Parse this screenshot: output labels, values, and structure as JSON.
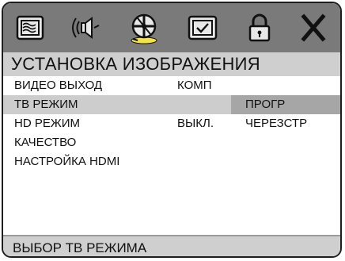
{
  "toolbar": {
    "tabs": [
      {
        "icon": "display-settings-icon"
      },
      {
        "icon": "audio-speaker-icon"
      },
      {
        "icon": "video-disc-icon",
        "active": true
      },
      {
        "icon": "preferences-check-icon"
      },
      {
        "icon": "lock-icon"
      },
      {
        "icon": "close-icon"
      }
    ]
  },
  "header": {
    "title": "УСТАНОВКА ИЗОБРАЖЕНИЯ"
  },
  "menu": {
    "items": [
      {
        "label": "ВИДЕО ВЫХОД",
        "value": "КОМП"
      },
      {
        "label": "ТВ РЕЖИМ",
        "value": ""
      },
      {
        "label": "HD РЕЖИМ",
        "value": "ВЫКЛ."
      },
      {
        "label": "КАЧЕСТВО",
        "value": ""
      },
      {
        "label": "НАСТРОЙКА HDMI",
        "value": ""
      }
    ],
    "selected_index": 1
  },
  "options": {
    "items": [
      "ПРОГР",
      "ЧЕРЕЗСТР"
    ],
    "highlighted_index": 0
  },
  "footer": {
    "hint": "ВЫБОР ТВ РЕЖИМА"
  },
  "colors": {
    "toolbar_bg": "#7a7a7a",
    "bar_bg": "#cfcfcf",
    "selected_row": "#cdcdcd",
    "highlighted_option": "#a6a6a6",
    "icon_fill": "#e8e8e8",
    "icon_stroke": "#111111"
  }
}
